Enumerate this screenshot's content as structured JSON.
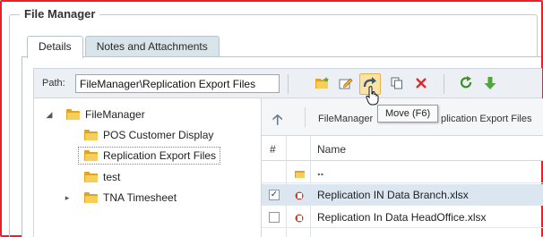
{
  "window": {
    "title": "File Manager"
  },
  "tabs": [
    {
      "label": "Details",
      "active": true
    },
    {
      "label": "Notes and Attachments",
      "active": false
    }
  ],
  "toolbar": {
    "path_label": "Path:",
    "path_value": "FileManager\\Replication Export Files",
    "buttons": [
      {
        "name": "new-folder-icon"
      },
      {
        "name": "rename-icon"
      },
      {
        "name": "move-icon"
      },
      {
        "name": "copy-icon"
      },
      {
        "name": "delete-icon"
      },
      {
        "name": "refresh-icon"
      },
      {
        "name": "download-icon"
      }
    ],
    "tooltip": "Move (F6)"
  },
  "tree": {
    "root": "FileManager",
    "items": [
      {
        "label": "POS Customer Display"
      },
      {
        "label": "Replication Export Files",
        "selected": true
      },
      {
        "label": "test"
      },
      {
        "label": "TNA Timesheet",
        "expandable": true
      }
    ]
  },
  "files": {
    "breadcrumb_start": "FileManager",
    "breadcrumb_end": "plication Export Files",
    "columns": [
      "#",
      "Name"
    ],
    "parent": "..",
    "rows": [
      {
        "name": "Replication IN Data Branch.xlsx",
        "checked": true
      },
      {
        "name": "Replication In Data HeadOffice.xlsx",
        "checked": false
      }
    ]
  },
  "colors": {
    "frame_border": "#e8202a",
    "accent": "#d9e3ea",
    "folder": "#f5cf5a"
  }
}
